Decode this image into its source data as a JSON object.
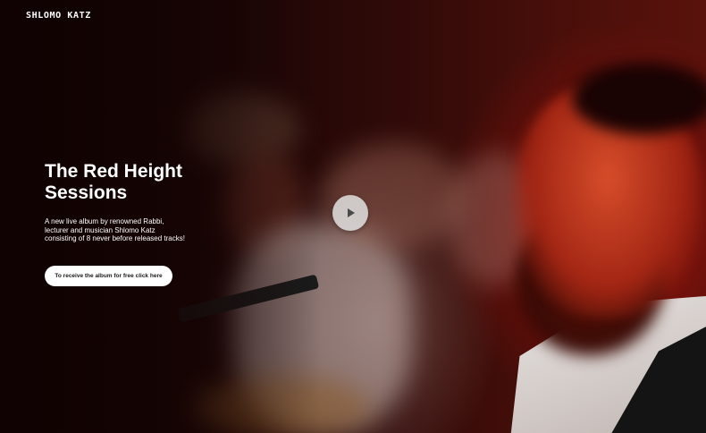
{
  "header": {
    "brand": "SHLOMO KATZ"
  },
  "hero": {
    "title_line1": "The Red Height",
    "title_line2": "Sessions",
    "description": "A new live album by renowned Rabbi, lecturer and musician Shlomo Katz consisting of 8 never before released tracks!",
    "cta_label": "To receive the album for free click here",
    "play_icon": "play-icon"
  },
  "colors": {
    "text": "#ffffff",
    "button_bg": "#ffffff",
    "button_text": "#1a1a1a",
    "accent_red": "#9a1a10",
    "play_bg": "#e1e1e1"
  }
}
